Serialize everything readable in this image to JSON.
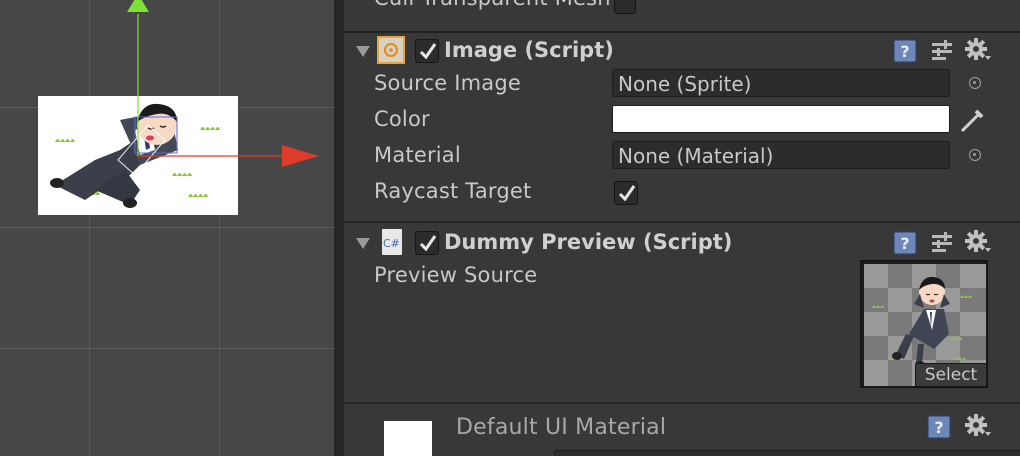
{
  "inspector": {
    "cutoff_label": "Cull Transparent Mesh",
    "image_component": {
      "title": "Image (Script)",
      "rows": {
        "source_image": {
          "label": "Source Image",
          "value": "None (Sprite)"
        },
        "color": {
          "label": "Color",
          "value": "#ffffff"
        },
        "material": {
          "label": "Material",
          "value": "None (Material)"
        },
        "raycast_target": {
          "label": "Raycast Target",
          "checked": true
        }
      }
    },
    "dummy_preview_component": {
      "title": "Dummy Preview (Script)",
      "icon_text": "C#",
      "preview_source_label": "Preview Source",
      "select_label": "Select"
    },
    "material_section": {
      "title": "Default UI Material"
    }
  },
  "icons": [
    "help-icon",
    "presets-icon",
    "gear-icon",
    "object-picker-icon",
    "eyedropper-icon",
    "foldout-arrow-icon",
    "script-icon",
    "image-component-icon"
  ],
  "colors": {
    "scene_bg": "#474747",
    "inspector_bg": "#383838",
    "gizmo_x": "#e03a2a",
    "gizmo_y": "#7fe03a"
  }
}
